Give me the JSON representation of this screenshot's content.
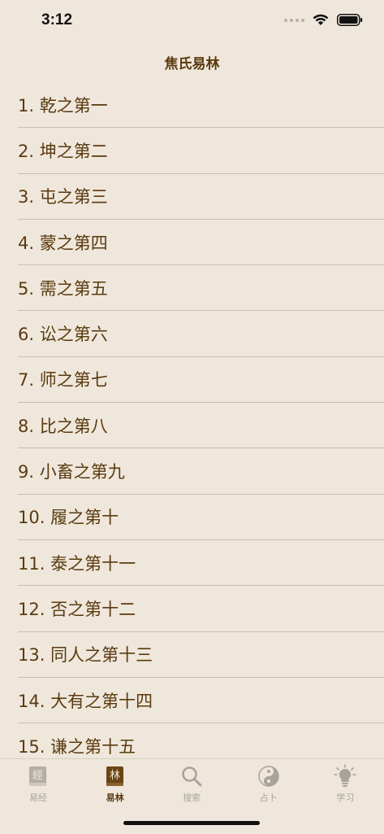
{
  "status_bar": {
    "time": "3:12"
  },
  "nav": {
    "title": "焦氏易林"
  },
  "list": {
    "items": [
      {
        "label": "1. 乾之第一"
      },
      {
        "label": "2. 坤之第二"
      },
      {
        "label": "3. 屯之第三"
      },
      {
        "label": "4. 蒙之第四"
      },
      {
        "label": "5. 需之第五"
      },
      {
        "label": "6. 讼之第六"
      },
      {
        "label": "7. 师之第七"
      },
      {
        "label": "8. 比之第八"
      },
      {
        "label": "9. 小畜之第九"
      },
      {
        "label": "10. 履之第十"
      },
      {
        "label": "11. 泰之第十一"
      },
      {
        "label": "12. 否之第十二"
      },
      {
        "label": "13. 同人之第十三"
      },
      {
        "label": "14. 大有之第十四"
      },
      {
        "label": "15. 谦之第十五"
      }
    ]
  },
  "tab_bar": {
    "tabs": [
      {
        "label": "易经",
        "icon": "book-icon",
        "icon_glyph": "經",
        "active": false
      },
      {
        "label": "易林",
        "icon": "book-active-icon",
        "icon_glyph": "林",
        "active": true
      },
      {
        "label": "搜索",
        "icon": "search-icon",
        "active": false
      },
      {
        "label": "占卜",
        "icon": "yin-yang-icon",
        "active": false
      },
      {
        "label": "学习",
        "icon": "lightbulb-icon",
        "active": false
      }
    ]
  },
  "colors": {
    "background": "#efe7db",
    "accent": "#5a3a10",
    "inactive": "#a9a39c",
    "separator": "#c9bfb0"
  }
}
